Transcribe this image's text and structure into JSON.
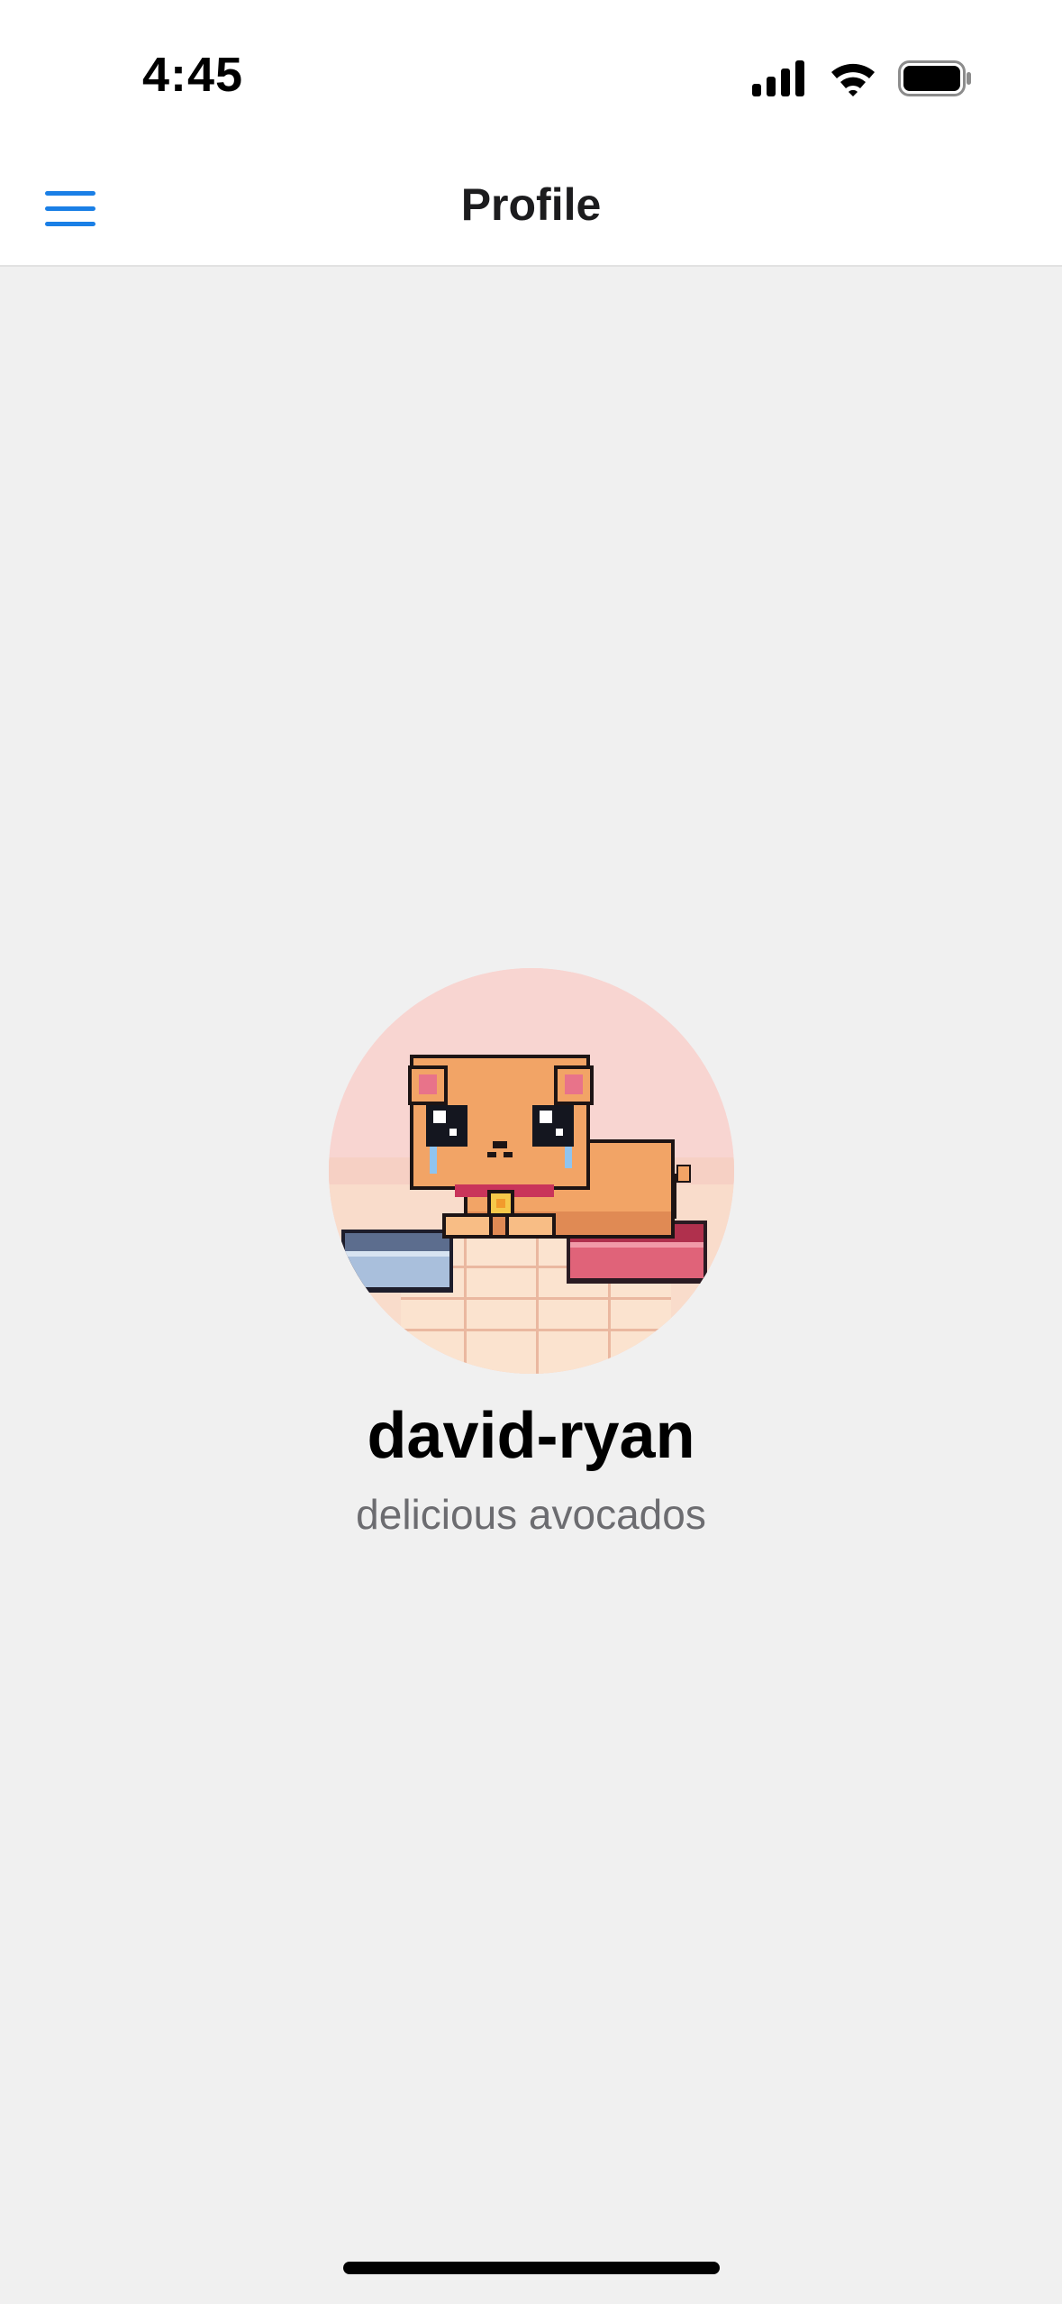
{
  "status_bar": {
    "time": "4:45",
    "icons": [
      "cellular-signal-icon",
      "wifi-icon",
      "battery-icon"
    ]
  },
  "nav": {
    "title": "Profile",
    "menu_icon": "hamburger-menu-icon",
    "accent_color": "#1a7fe6"
  },
  "profile": {
    "name": "david-ryan",
    "bio": "delicious avocados",
    "avatar": "pixel-art-cat-icon"
  },
  "colors": {
    "background": "#f0f0f0",
    "bar": "#ffffff",
    "secondary_text": "#6c6c70"
  }
}
